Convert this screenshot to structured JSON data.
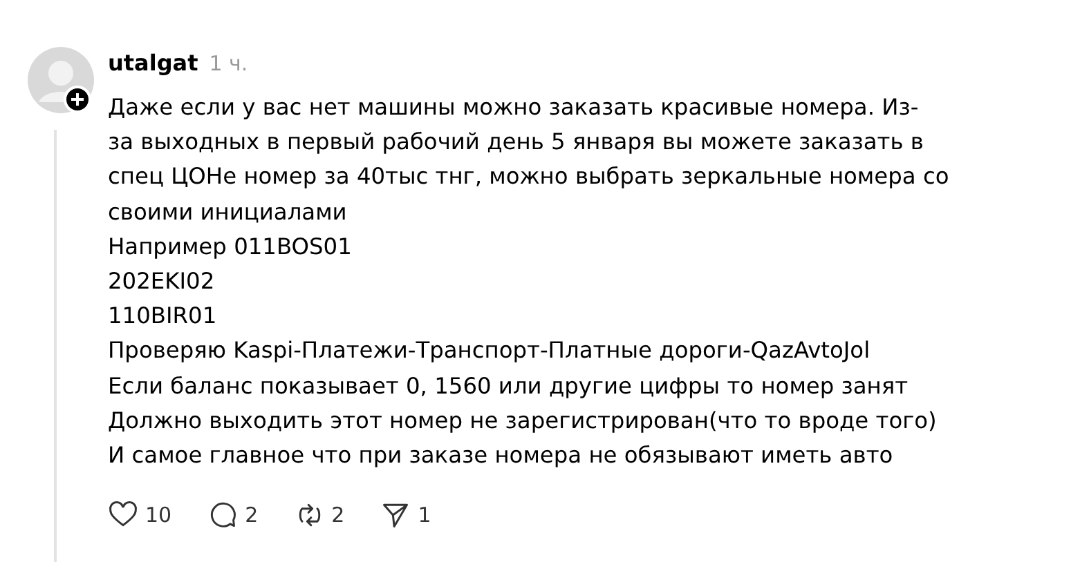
{
  "comment": {
    "author": "utalgat",
    "time": "1 ч.",
    "lines": [
      "Даже если у вас нет машины можно заказать красивые номера. Из-",
      "за выходных в первый рабочий день 5 января вы можете заказать в",
      "спец ЦОНе номер за 40тыс тнг, можно выбрать зеркальные номера со",
      "своими инициалами",
      "Например 011BOS01",
      "202EKI02",
      "110BIR01",
      "Проверяю Kaspi-Платежи-Транспорт-Платные дороги-QazAvtoJol",
      "Если баланс показывает 0, 1560 или другие цифры то номер занят",
      "Должно выходить этот номер не зарегистрирован(что то вроде того)",
      "И самое главное что при заказе номера не обязывают иметь авто"
    ],
    "actions": [
      {
        "kind": "like",
        "count": "10"
      },
      {
        "kind": "reply",
        "count": "2"
      },
      {
        "kind": "repost",
        "count": "2"
      },
      {
        "kind": "share",
        "count": "1"
      }
    ]
  }
}
